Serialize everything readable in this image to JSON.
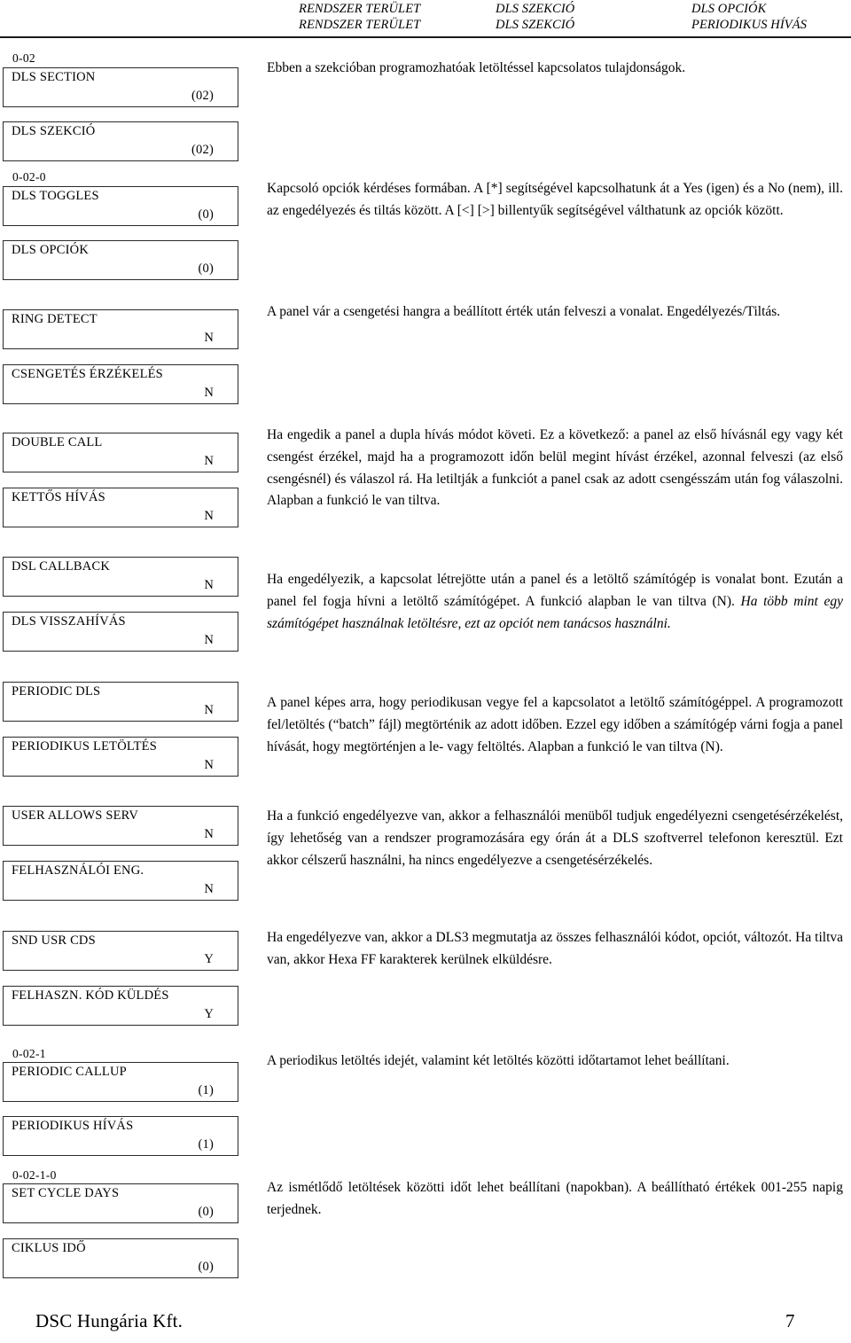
{
  "header": {
    "row1": {
      "col1": "RENDSZER TERÜLET",
      "col2": "DLS SZEKCIÓ",
      "col3": "DLS OPCIÓK"
    },
    "row2": {
      "col1": "RENDSZER TERÜLET",
      "col2": "DLS SZEKCIÓ",
      "col3": "PERIODIKUS HÍVÁS"
    }
  },
  "section_codes": {
    "dls_section": "0-02",
    "dls_toggles": "0-02-0",
    "periodic_callup": "0-02-1",
    "set_cycle_days": "0-02-1-0"
  },
  "boxes": [
    {
      "label": "DLS SECTION",
      "value": "(02)"
    },
    {
      "label": "DLS SZEKCIÓ",
      "value": "(02)"
    },
    {
      "label": "DLS TOGGLES",
      "value": "(0)"
    },
    {
      "label": "DLS OPCIÓK",
      "value": "(0)"
    },
    {
      "label": "RING DETECT",
      "value": "N"
    },
    {
      "label": "CSENGETÉS ÉRZÉKELÉS",
      "value": "N"
    },
    {
      "label": "DOUBLE CALL",
      "value": "N"
    },
    {
      "label": "KETTŐS HÍVÁS",
      "value": "N"
    },
    {
      "label": "DSL CALLBACK",
      "value": "N"
    },
    {
      "label": "DLS VISSZAHÍVÁS",
      "value": "N"
    },
    {
      "label": "PERIODIC DLS",
      "value": "N"
    },
    {
      "label": "PERIODIKUS LETÖLTÉS",
      "value": "N"
    },
    {
      "label": "USER ALLOWS SERV",
      "value": "N"
    },
    {
      "label": "FELHASZNÁLÓI ENG.",
      "value": "N"
    },
    {
      "label": "SND USR CDS",
      "value": "Y"
    },
    {
      "label": "FELHASZN. KÓD KÜLDÉS",
      "value": "Y"
    },
    {
      "label": "PERIODIC CALLUP",
      "value": "(1)"
    },
    {
      "label": "PERIODIKUS HÍVÁS",
      "value": "(1)"
    },
    {
      "label": "SET CYCLE DAYS",
      "value": "(0)"
    },
    {
      "label": "CIKLUS IDŐ",
      "value": "(0)"
    }
  ],
  "paragraphs": {
    "dls_section": "Ebben a szekcióban programozhatóak letöltéssel kapcsolatos tulajdonságok.",
    "dls_toggles": "Kapcsoló opciók kérdéses formában. A [*] segítségével kapcsolhatunk át a Yes (igen) és a No (nem), ill. az engedélyezés és tiltás között. A [<] [>] billentyűk segítségével válthatunk az opciók között.",
    "ring_detect": "A panel vár a csengetési hangra a beállított érték után felveszi a vonalat. Engedélyezés/Tiltás.",
    "double_call": "Ha engedik a panel a dupla hívás módot követi. Ez a következő: a panel az első hívásnál egy vagy két csengést érzékel, majd ha a programozott időn belül megint hívást érzékel, azonnal felveszi (az első csengésnél) és válaszol rá. Ha letiltják a funkciót a panel csak az adott csengésszám után fog válaszolni. Alapban a funkció le van tiltva.",
    "dsl_callback_normal": "Ha engedélyezik, a kapcsolat létrejötte után a panel és a letöltő számítógép is vonalat bont. Ezután a panel fel fogja hívni a letöltő számítógépet. A funkció alapban le van tiltva (N). ",
    "dsl_callback_italic": "Ha több mint egy számítógépet használnak letöltésre, ezt az opciót nem tanácsos használni.",
    "periodic_dls": "A panel képes arra, hogy periodikusan vegye fel a kapcsolatot a letöltő számítógéppel. A programozott fel/letöltés (“batch” fájl) megtörténik az adott időben. Ezzel egy időben a számítógép várni fogja a panel hívását, hogy megtörténjen a le- vagy feltöltés. Alapban a funkció le van tiltva (N).",
    "user_allows_serv": "Ha a funkció engedélyezve van, akkor a felhasználói menüből tudjuk engedélyezni csengetésérzékelést, így lehetőség van a rendszer programozására egy órán át a DLS szoftverrel telefonon keresztül. Ezt akkor célszerű használni, ha nincs engedélyezve a csengetésérzékelés.",
    "snd_usr_cds": "Ha engedélyezve van, akkor a DLS3 megmutatja az összes felhasználói kódot, opciót, változót. Ha tiltva van, akkor Hexa FF karakterek kerülnek elküldésre.",
    "periodic_callup": "A periodikus letöltés idejét, valamint két letöltés közötti időtartamot lehet beállítani.",
    "set_cycle_days": "Az ismétlődő letöltések közötti időt lehet beállítani (napokban). A beállítható értékek 001-255 napig terjednek."
  },
  "footer": {
    "company": "DSC Hungária Kft.",
    "page_number": "7"
  }
}
